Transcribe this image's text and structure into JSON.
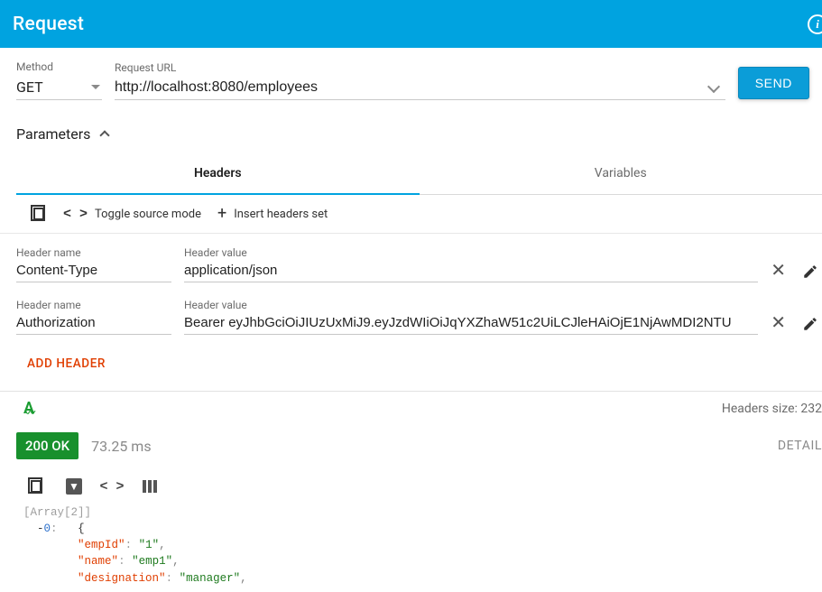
{
  "banner": {
    "title": "Request"
  },
  "request": {
    "method_label": "Method",
    "method_value": "GET",
    "url_label": "Request URL",
    "url_value": "http://localhost:8080/employees",
    "send_label": "SEND"
  },
  "parameters": {
    "label": "Parameters"
  },
  "tabs": {
    "headers": "Headers",
    "variables": "Variables"
  },
  "headers_toolbar": {
    "toggle_label": "Toggle source mode",
    "insert_label": "Insert headers set"
  },
  "headers": [
    {
      "name_label": "Header name",
      "value_label": "Header value",
      "name": "Content-Type",
      "value": "application/json"
    },
    {
      "name_label": "Header name",
      "value_label": "Header value",
      "name": "Authorization",
      "value": "Bearer eyJhbGciOiJIUzUxMiJ9.eyJzdWIiOiJqYXZhaW51c2UiLCJleHAiOjE1NjAwMDI2NTU"
    }
  ],
  "add_header_label": "ADD HEADER",
  "response_meta": {
    "headers_size_text": "Headers size: 232"
  },
  "response": {
    "status_text": "200 OK",
    "time_text": "73.25 ms",
    "details_label": "DETAIL"
  },
  "json": {
    "array_label": "Array[2]",
    "idx0": "0",
    "obj0": {
      "empId": "1",
      "name": "emp1",
      "designation": "manager"
    },
    "keys": {
      "empId": "empId",
      "name": "name",
      "designation": "designation"
    }
  }
}
